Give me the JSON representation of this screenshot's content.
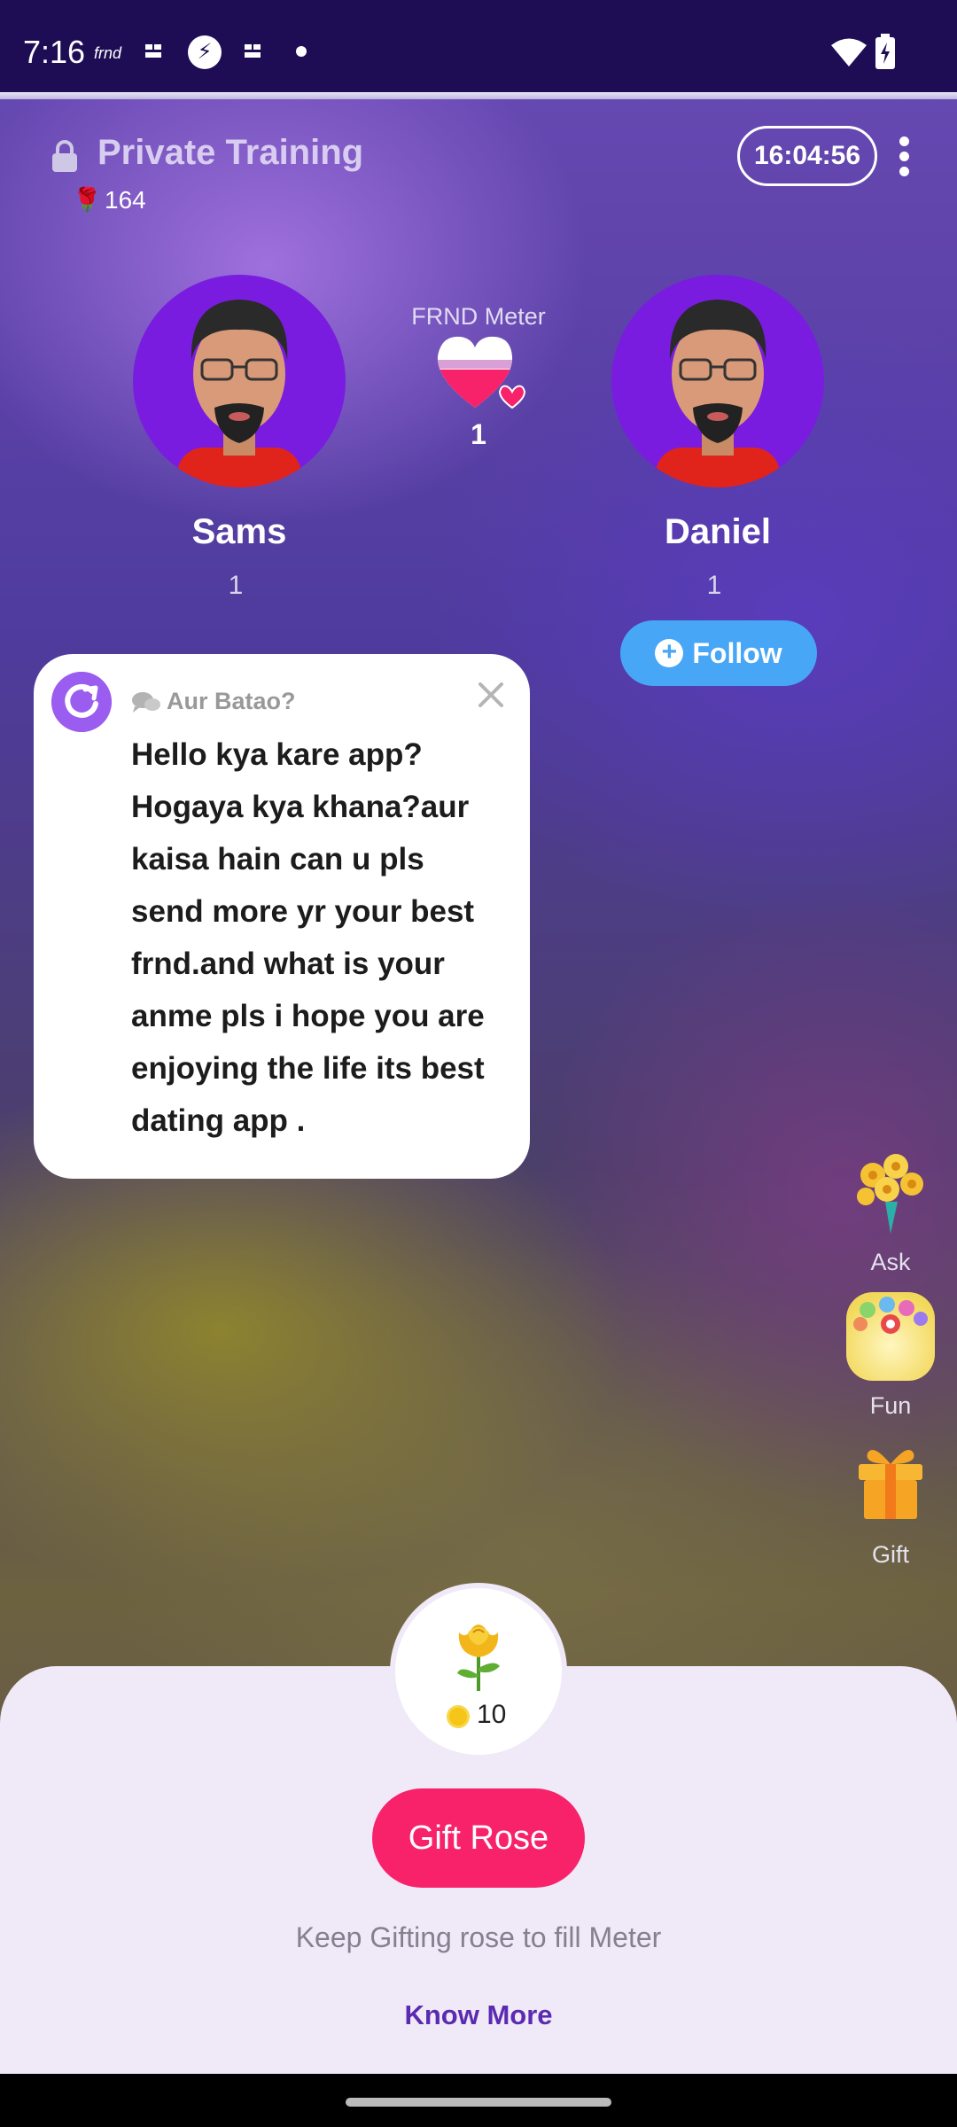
{
  "status_bar": {
    "time": "7:16",
    "app_label": "frnd",
    "icons": [
      "frnd-logo-icon",
      "grid-icon",
      "bolt-icon",
      "grid-icon",
      "dot-icon",
      "wifi-icon",
      "battery-charging-icon"
    ]
  },
  "header": {
    "title": "Private Training",
    "rose_count": "164",
    "timer": "16:04:56",
    "lock_icon": "lock-icon",
    "more_icon": "more-vertical-icon"
  },
  "users": {
    "left": {
      "name": "Sams",
      "score": "1"
    },
    "right": {
      "name": "Daniel",
      "score": "1"
    }
  },
  "meter": {
    "label": "FRND Meter",
    "value": "1",
    "fill_fraction": 0.55
  },
  "follow": {
    "label": "Follow"
  },
  "message_card": {
    "hint": "Aur Batao?",
    "text": "Hello kya kare app? Hogaya kya khana?aur kaisa hain can u pls send more yr your best frnd.and what is your anme pls i hope you are enjoying the life its best dating app ."
  },
  "side_actions": {
    "ask": "Ask",
    "fun": "Fun",
    "gift": "Gift"
  },
  "sheet": {
    "price": "10",
    "gift_button": "Gift Rose",
    "hint": "Keep Gifting rose to fill Meter",
    "know_more": "Know More"
  },
  "colors": {
    "accent_pink": "#f8226b",
    "follow_blue": "#47a6f5",
    "avatar_bg": "#7a1ce0",
    "link_purple": "#5a2bb0"
  }
}
